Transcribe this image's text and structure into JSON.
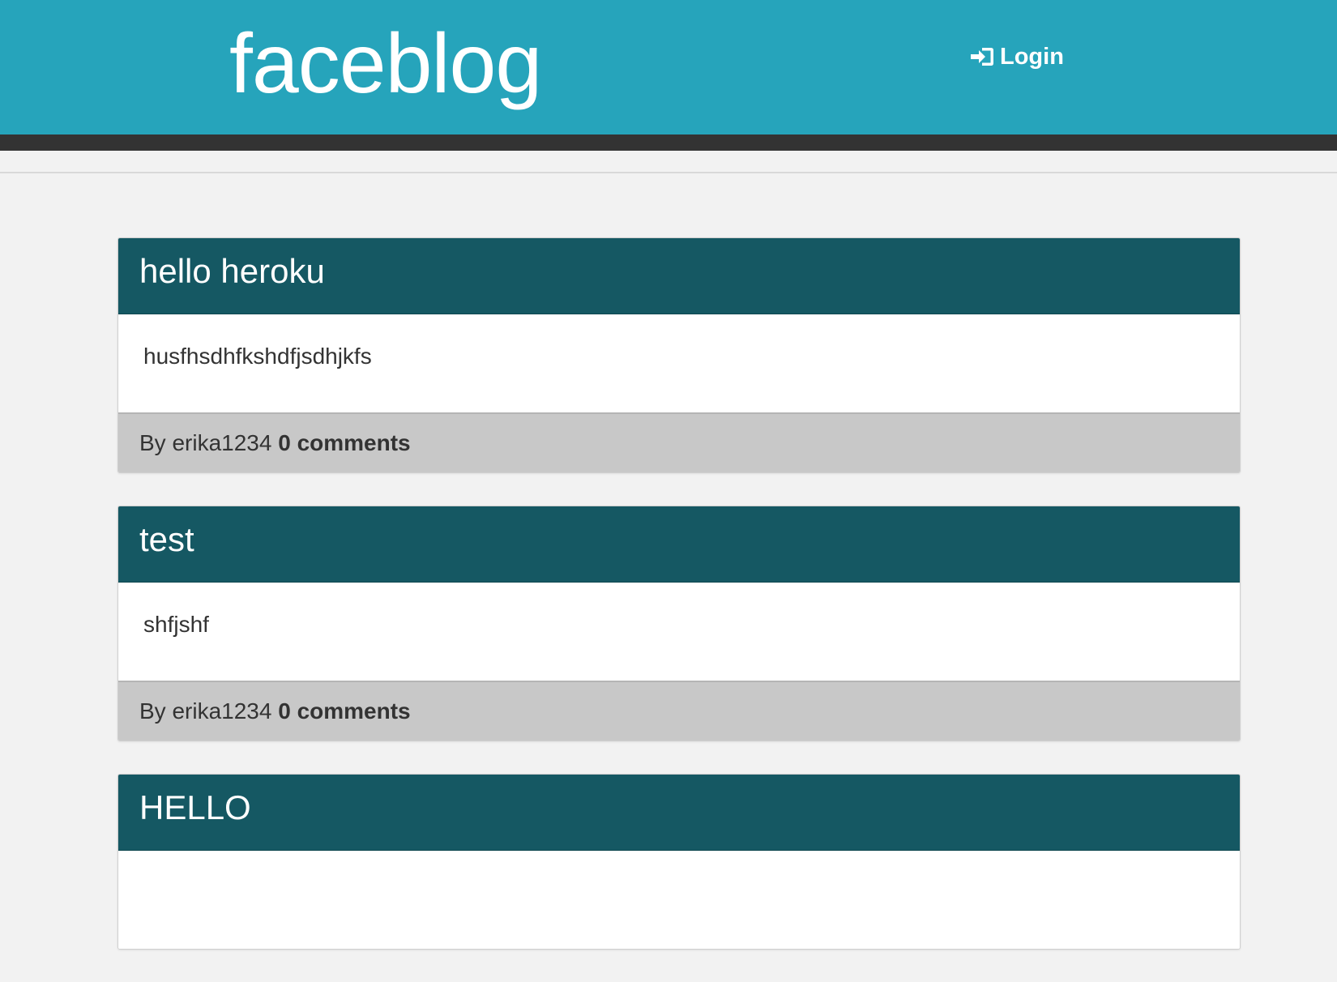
{
  "header": {
    "brand": "faceblog",
    "login_label": "Login",
    "login_icon": "sign-in-icon"
  },
  "posts": [
    {
      "title": "hello heroku",
      "body": "husfhsdhfkshdfjsdhjkfs",
      "by_prefix": "By",
      "author": "erika1234",
      "comments": "0 comments"
    },
    {
      "title": "test",
      "body": "shfjshf",
      "by_prefix": "By",
      "author": "erika1234",
      "comments": "0 comments"
    },
    {
      "title": "HELLO",
      "body": "",
      "by_prefix": "",
      "author": "",
      "comments": ""
    }
  ],
  "colors": {
    "header_bg": "#26a4bb",
    "dark_bar": "#333333",
    "post_head": "#155863",
    "post_foot": "#c8c8c8",
    "page_bg": "#f2f2f2"
  }
}
